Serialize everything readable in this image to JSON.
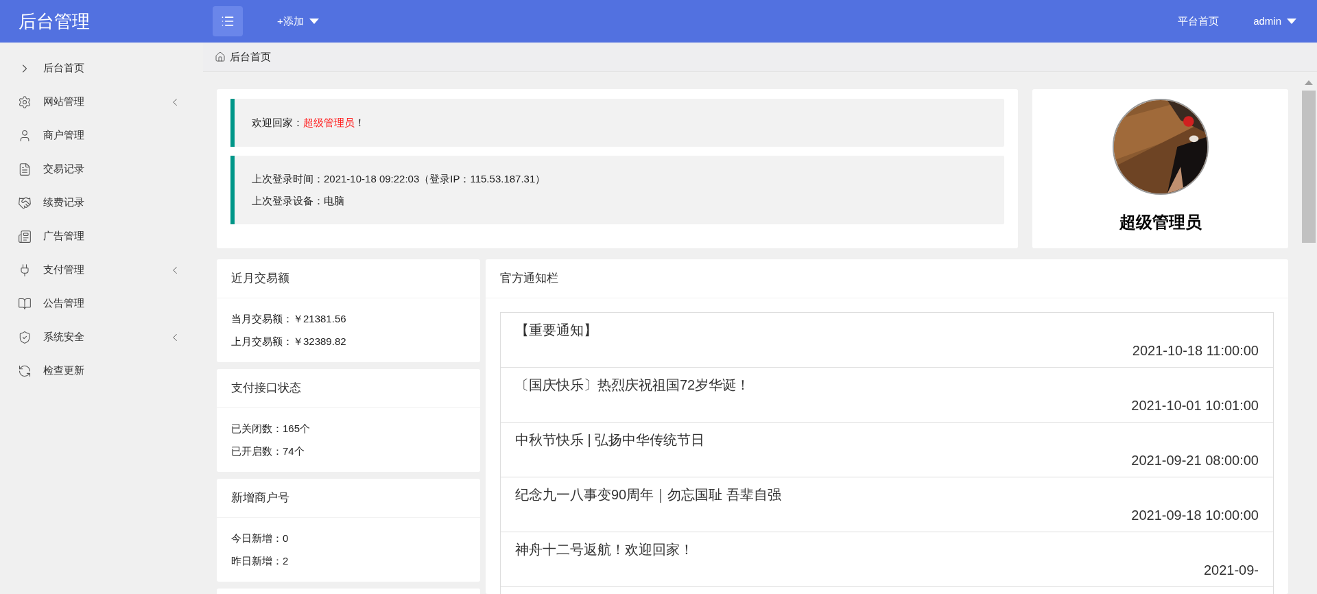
{
  "header": {
    "title": "后台管理",
    "add_menu": "+添加",
    "links": [
      "平台首页"
    ],
    "user": "admin"
  },
  "sidebar": {
    "items": [
      {
        "label": "后台首页",
        "has_submenu": false
      },
      {
        "label": "网站管理",
        "has_submenu": true
      },
      {
        "label": "商户管理",
        "has_submenu": false
      },
      {
        "label": "交易记录",
        "has_submenu": false
      },
      {
        "label": "续费记录",
        "has_submenu": false
      },
      {
        "label": "广告管理",
        "has_submenu": false
      },
      {
        "label": "支付管理",
        "has_submenu": true
      },
      {
        "label": "公告管理",
        "has_submenu": false
      },
      {
        "label": "系统安全",
        "has_submenu": true
      },
      {
        "label": "检查更新",
        "has_submenu": false
      }
    ]
  },
  "breadcrumb": "后台首页",
  "welcome": {
    "prefix": "欢迎回家：",
    "name": "超级管理员",
    "suffix": "！"
  },
  "login": {
    "time_line": "上次登录时间：2021-10-18 09:22:03（登录IP：115.53.187.31）",
    "device_line": "上次登录设备：电脑"
  },
  "profile": {
    "name": "超级管理员"
  },
  "stat_cards": [
    {
      "title": "近月交易额",
      "lines": [
        "当月交易额：￥21381.56",
        "上月交易额：￥32389.82"
      ]
    },
    {
      "title": "支付接口状态",
      "lines": [
        "已关闭数：165个",
        "已开启数：74个"
      ]
    },
    {
      "title": "新增商户号",
      "lines": [
        "今日新增：0",
        "昨日新增：2"
      ]
    }
  ],
  "notices": {
    "title": "官方通知栏",
    "items": [
      {
        "title": "【重要通知】",
        "time": "2021-10-18 11:00:00"
      },
      {
        "title": "〔国庆快乐〕热烈庆祝祖国72岁华诞！",
        "time": "2021-10-01 10:01:00"
      },
      {
        "title": "中秋节快乐 | 弘扬中华传统节日",
        "time": "2021-09-21 08:00:00"
      },
      {
        "title": "纪念九一八事变90周年｜勿忘国耻 吾辈自强",
        "time": "2021-09-18 10:00:00"
      },
      {
        "title": "神舟十二号返航！欢迎回家！",
        "time": "2021-09-"
      }
    ]
  }
}
